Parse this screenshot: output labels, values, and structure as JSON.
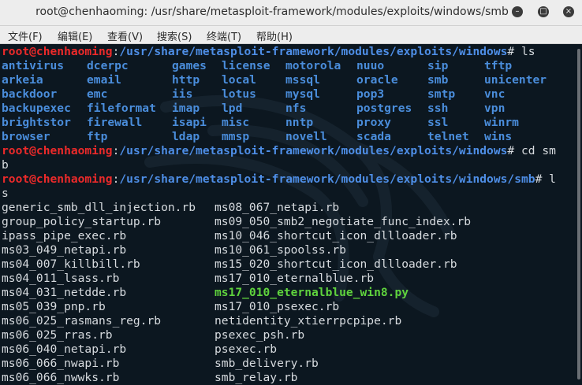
{
  "window": {
    "title": "root@chenhaoming: /usr/share/metasploit-framework/modules/exploits/windows/smb",
    "buttons": {
      "minimize": "–",
      "maximize": "□",
      "close": "×"
    }
  },
  "menu": {
    "file": "文件(F)",
    "edit": "编辑(E)",
    "view": "查看(V)",
    "search": "搜索(S)",
    "terminal": "终端(T)",
    "help": "帮助(H)"
  },
  "terminal": {
    "prompt1": {
      "user": "root@chenhaoming",
      "path": "/usr/share/metasploit-framework/modules/exploits/windows",
      "command": "# ls"
    },
    "ls_windows": [
      [
        "antivirus",
        "dcerpc",
        "games",
        "license",
        "motorola",
        "nuuo",
        "sip",
        "tftp"
      ],
      [
        "arkeia",
        "email",
        "http",
        "local",
        "mssql",
        "oracle",
        "smb",
        "unicenter"
      ],
      [
        "backdoor",
        "emc",
        "iis",
        "lotus",
        "mysql",
        "pop3",
        "smtp",
        "vnc"
      ],
      [
        "backupexec",
        "fileformat",
        "imap",
        "lpd",
        "nfs",
        "postgres",
        "ssh",
        "vpn"
      ],
      [
        "brightstor",
        "firewall",
        "isapi",
        "misc",
        "nntp",
        "proxy",
        "ssl",
        "winrm"
      ],
      [
        "browser",
        "ftp",
        "ldap",
        "mmsp",
        "novell",
        "scada",
        "telnet",
        "wins"
      ]
    ],
    "prompt2": {
      "user": "root@chenhaoming",
      "path": "/usr/share/metasploit-framework/modules/exploits/windows",
      "command": "# cd sm",
      "wrap": "b"
    },
    "prompt3": {
      "user": "root@chenhaoming",
      "path": "/usr/share/metasploit-framework/modules/exploits/windows/smb",
      "command": "# l",
      "wrap": "s"
    },
    "ls_smb": [
      {
        "left": "generic_smb_dll_injection.rb",
        "right": "ms08_067_netapi.rb"
      },
      {
        "left": "group_policy_startup.rb",
        "right": "ms09_050_smb2_negotiate_func_index.rb"
      },
      {
        "left": "ipass_pipe_exec.rb",
        "right": "ms10_046_shortcut_icon_dllloader.rb"
      },
      {
        "left": "ms03_049_netapi.rb",
        "right": "ms10_061_spoolss.rb"
      },
      {
        "left": "ms04_007_killbill.rb",
        "right": "ms15_020_shortcut_icon_dllloader.rb"
      },
      {
        "left": "ms04_011_lsass.rb",
        "right": "ms17_010_eternalblue.rb"
      },
      {
        "left": "ms04_031_netdde.rb",
        "right": "ms17_010_eternalblue_win8.py",
        "right_exec": true
      },
      {
        "left": "ms05_039_pnp.rb",
        "right": "ms17_010_psexec.rb"
      },
      {
        "left": "ms06_025_rasmans_reg.rb",
        "right": "netidentity_xtierrpcpipe.rb"
      },
      {
        "left": "ms06_025_rras.rb",
        "right": "psexec_psh.rb"
      },
      {
        "left": "ms06_040_netapi.rb",
        "right": "psexec.rb"
      },
      {
        "left": "ms06_066_nwapi.rb",
        "right": "smb_delivery.rb"
      },
      {
        "left": "ms06_066_nwwks.rb",
        "right": "smb_relay.rb"
      }
    ]
  }
}
